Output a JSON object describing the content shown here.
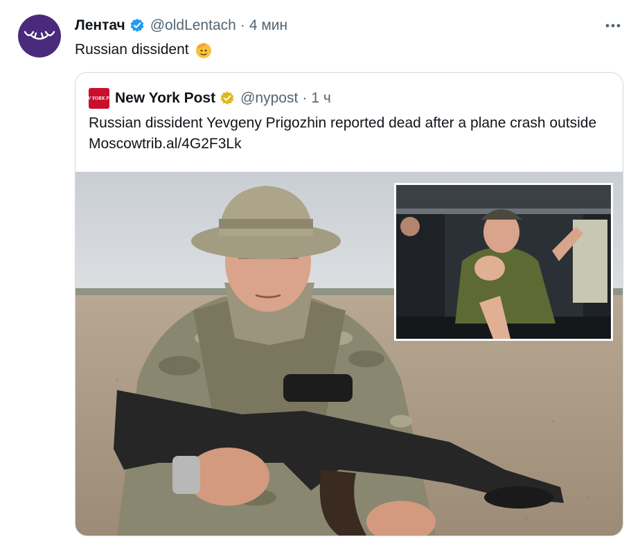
{
  "tweet": {
    "display_name": "Лентач",
    "handle": "@oldLentach",
    "separator": "·",
    "time": "4 мин",
    "text": "Russian dissident",
    "emoji": "saluting-face-emoji",
    "more_icon": "more-horizontal-icon"
  },
  "quote": {
    "logo_text": "NEW YORK POST",
    "display_name": "New York Post",
    "handle": "@nypost",
    "separator": "·",
    "time": "1 ч",
    "text": "Russian dissident Yevgeny Prigozhin reported dead after a plane crash outside Moscowtrib.al/4G2F3Lk",
    "media": {
      "main_image": "man-in-camouflage-with-rifle-photo",
      "inset_image": "man-in-vehicle-shaking-hands-photo"
    }
  },
  "colors": {
    "verified_blue": "#1d9bf0",
    "verified_gold": "#e2b719",
    "nypost_red": "#c8102e",
    "avatar_purple": "#4a2a7c",
    "secondary_text": "#536471"
  }
}
